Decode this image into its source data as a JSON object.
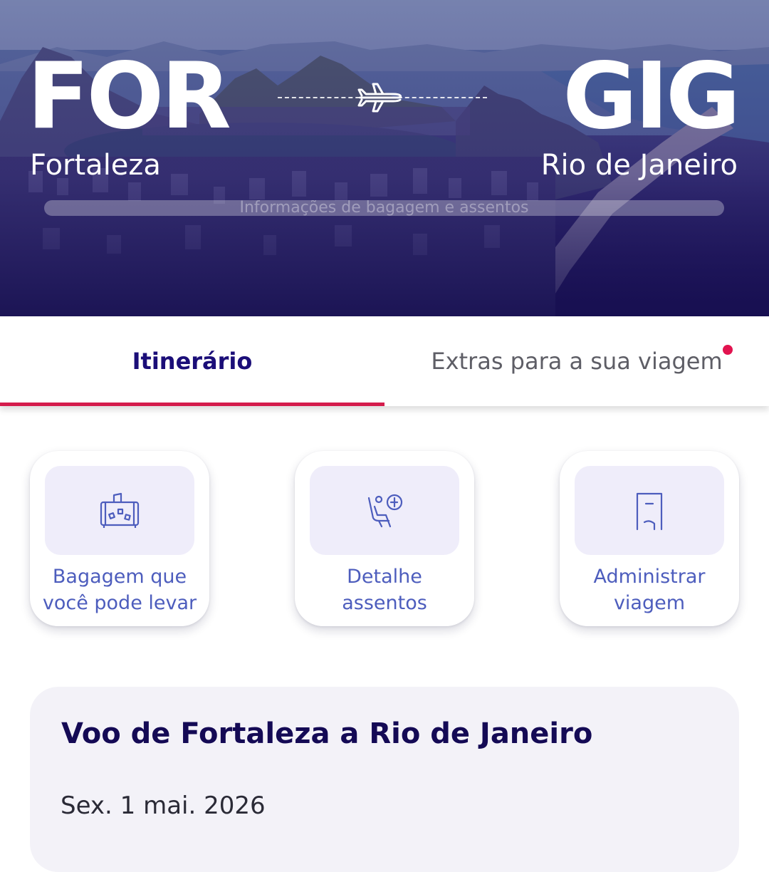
{
  "hero": {
    "origin_code": "FOR",
    "origin_city": "Fortaleza",
    "destination_code": "GIG",
    "destination_city": "Rio de Janeiro",
    "info_text": "Informações de bagagem e assentos",
    "icon": "airplane-icon"
  },
  "tabs": [
    {
      "label": "Itinerário",
      "active": true
    },
    {
      "label": "Extras para a sua viagem",
      "active": false,
      "has_notification": true
    }
  ],
  "quick_actions": [
    {
      "label_line1": "Bagagem que",
      "label_line2": "você pode levar",
      "icon": "luggage-icon"
    },
    {
      "label_line1": "Detalhe",
      "label_line2": "assentos",
      "icon": "seat-icon"
    },
    {
      "label_line1": "Administrar",
      "label_line2": "viagem",
      "icon": "door-icon"
    }
  ],
  "flight": {
    "title": "Voo de Fortaleza a Rio de Janeiro",
    "date": "Sex. 1 mai. 2026"
  },
  "colors": {
    "brand_navy": "#1b0e78",
    "accent_red": "#d41c4c",
    "icon_blue": "#4d5dbd",
    "tile_lavender": "#efedfa"
  }
}
